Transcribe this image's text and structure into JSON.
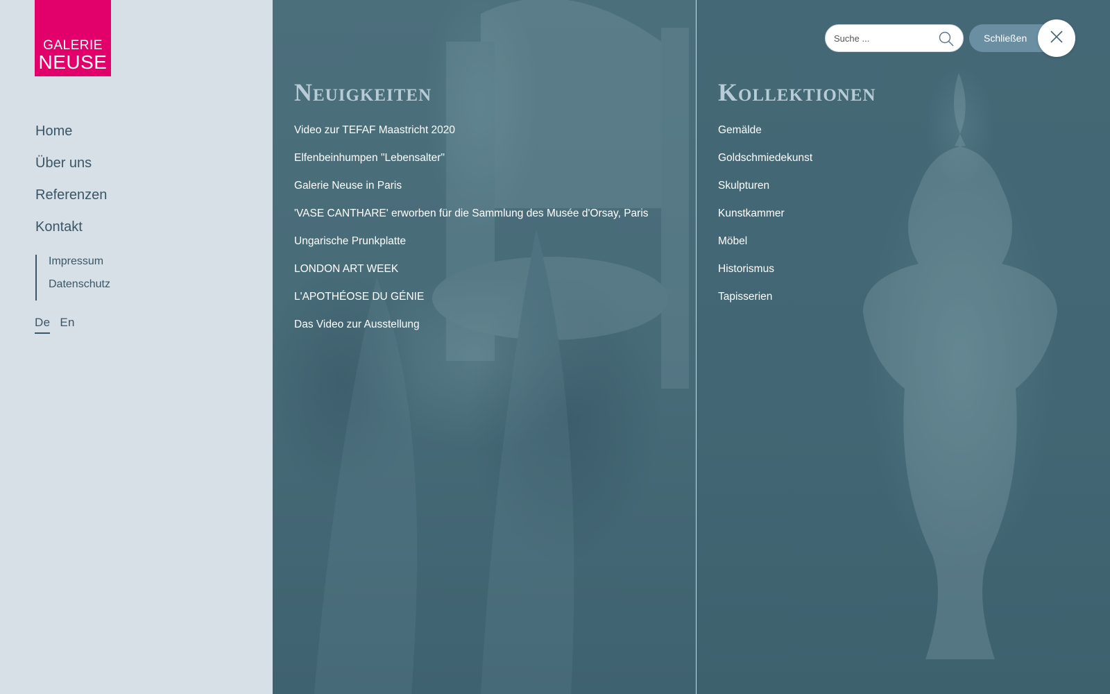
{
  "logo": {
    "line1": "GALERIE",
    "line2": "NEUSE"
  },
  "main_nav": [
    {
      "label": "Home"
    },
    {
      "label": "Über uns"
    },
    {
      "label": "Referenzen"
    },
    {
      "label": "Kontakt"
    }
  ],
  "sub_nav": [
    {
      "label": "Impressum"
    },
    {
      "label": "Datenschutz"
    }
  ],
  "lang": {
    "de": "De",
    "en": "En",
    "active": "De"
  },
  "news": {
    "title": "Neuigkeiten",
    "items": [
      "Video zur TEFAF Maastricht 2020",
      "Elfenbeinhumpen \"Lebensalter\"",
      "Galerie Neuse in Paris",
      "'VASE CANTHARE' erworben für die Sammlung des Musée d'Orsay, Paris",
      "Ungarische Prunkplatte",
      "LONDON ART WEEK",
      "L'APOTHÉOSE DU GÉNIE",
      "Das Video zur Ausstellung"
    ]
  },
  "collections": {
    "title": "Kollektionen",
    "items": [
      "Gemälde",
      "Goldschmiedekunst",
      "Skulpturen",
      "Kunstkammer",
      "Möbel",
      "Historismus",
      "Tapisserien"
    ]
  },
  "search": {
    "placeholder": "Suche ...",
    "value": ""
  },
  "close": {
    "label": "Schließen"
  },
  "colors": {
    "brand": "#e2006a",
    "sidebar_bg": "#d8e0e7",
    "nav_text": "#3a5566",
    "overlay": "#466a77",
    "close_pill": "#6b8fa2"
  },
  "icons": {
    "search": "search-icon",
    "close": "close-icon"
  }
}
